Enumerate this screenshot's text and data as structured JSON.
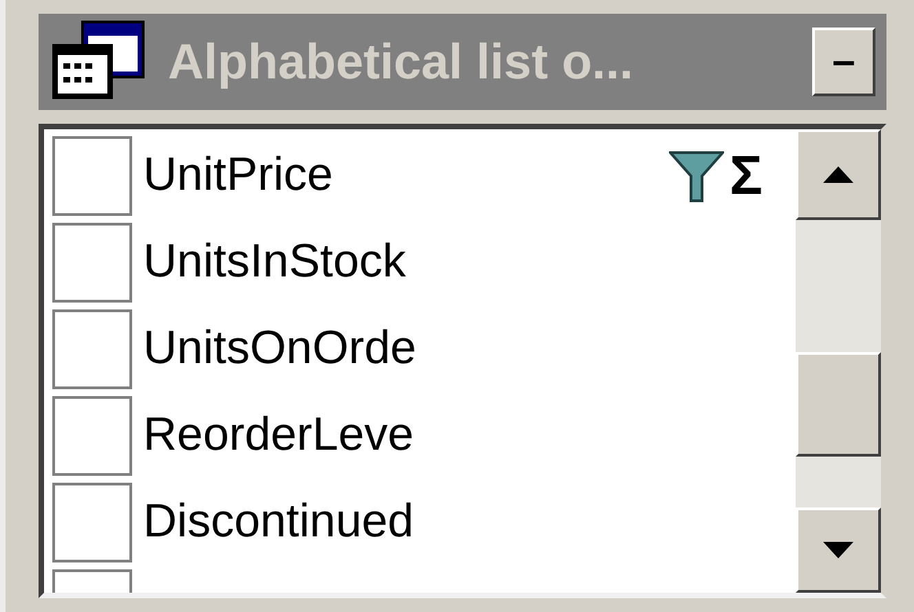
{
  "window": {
    "title": "Alphabetical list o...",
    "minimize_label": "–"
  },
  "field_list": {
    "sum_mark": "Σ",
    "fields": [
      {
        "label": "UnitPrice",
        "checked": false
      },
      {
        "label": "UnitsInStock",
        "checked": false
      },
      {
        "label": "UnitsOnOrde",
        "checked": false
      },
      {
        "label": "ReorderLeve",
        "checked": false
      },
      {
        "label": "Discontinued",
        "checked": false
      },
      {
        "checked": false
      }
    ]
  }
}
